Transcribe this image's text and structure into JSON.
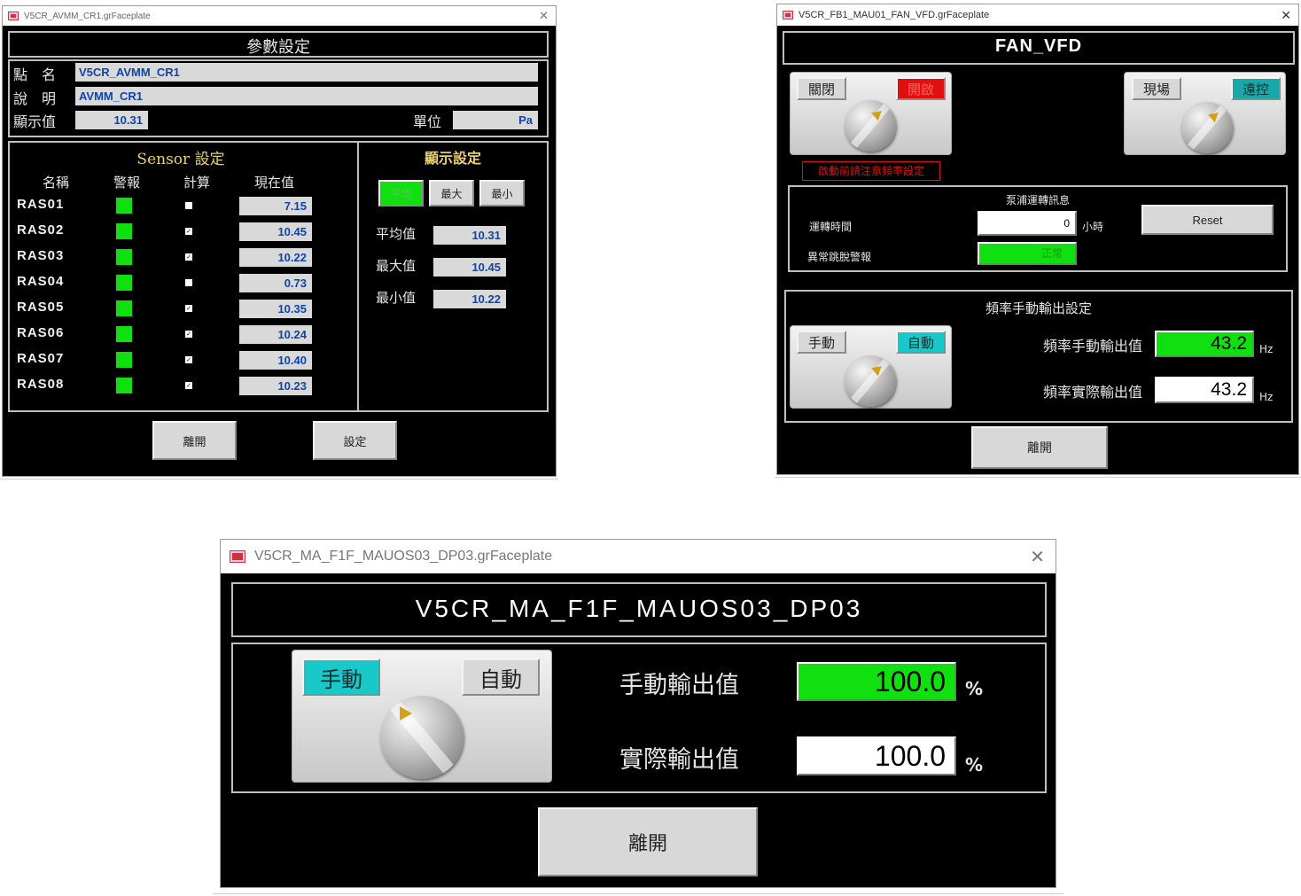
{
  "win1": {
    "title": "V5CR_AVMM_CR1.grFaceplate",
    "header": "參數設定",
    "point_label": "點　名",
    "point_value": "V5CR_AVMM_CR1",
    "desc_label": "說　明",
    "desc_value": "AVMM_CR1",
    "display_label": "顯示值",
    "display_value": "10.31",
    "unit_label": "單位",
    "unit_value": "Pa",
    "sensor_title": "Sensor  設定",
    "col_name": "名稱",
    "col_alarm": "警報",
    "col_calc": "計算",
    "col_value": "現在值",
    "sensors": [
      {
        "name": "RAS01",
        "checked": false,
        "value": "7.15"
      },
      {
        "name": "RAS02",
        "checked": true,
        "value": "10.45"
      },
      {
        "name": "RAS03",
        "checked": true,
        "value": "10.22"
      },
      {
        "name": "RAS04",
        "checked": false,
        "value": "0.73"
      },
      {
        "name": "RAS05",
        "checked": true,
        "value": "10.35"
      },
      {
        "name": "RAS06",
        "checked": true,
        "value": "10.24"
      },
      {
        "name": "RAS07",
        "checked": true,
        "value": "10.40"
      },
      {
        "name": "RAS08",
        "checked": true,
        "value": "10.23"
      }
    ],
    "display_title": "顯示設定",
    "btn_avg": "平均",
    "btn_max": "最大",
    "btn_min": "最小",
    "avg_label": "平均值",
    "avg_value": "10.31",
    "max_label": "最大值",
    "max_value": "10.45",
    "min_label": "最小值",
    "min_value": "10.22",
    "btn_close": "離開",
    "btn_set": "設定"
  },
  "win2": {
    "title": "V5CR_FB1_MAU01_FAN_VFD.grFaceplate",
    "header": "FAN_VFD",
    "btn_off": "關閉",
    "btn_on": "開啟",
    "btn_local": "現場",
    "btn_remote": "遠控",
    "warning": "啟動前請注意頻率設定",
    "pump_title": "泵浦運轉訊息",
    "runtime_label": "運轉時間",
    "runtime_value": "0",
    "runtime_unit": "小時",
    "reset_label": "Reset",
    "trip_label": "異常跳脫警報",
    "trip_value": "正常",
    "freq_title": "頻率手動輸出設定",
    "btn_manual": "手動",
    "btn_auto": "自動",
    "manual_out_label": "頻率手動輸出值",
    "manual_out_value": "43.2",
    "actual_out_label": "頻率實際輸出值",
    "actual_out_value": "43.2",
    "unit_hz": "Hz",
    "btn_close": "離開"
  },
  "win3": {
    "title": "V5CR_MA_F1F_MAUOS03_DP03.grFaceplate",
    "header": "V5CR_MA_F1F_MAUOS03_DP03",
    "btn_manual": "手動",
    "btn_auto": "自動",
    "manual_out_label": "手動輸出值",
    "manual_out_value": "100.0",
    "actual_out_label": "實際輸出值",
    "actual_out_value": "100.0",
    "unit": "%",
    "btn_close": "離開"
  },
  "colors": {
    "green": "#10e010",
    "cyan": "#19c8c8",
    "red": "#e01010",
    "field_text": "#1144aa"
  }
}
